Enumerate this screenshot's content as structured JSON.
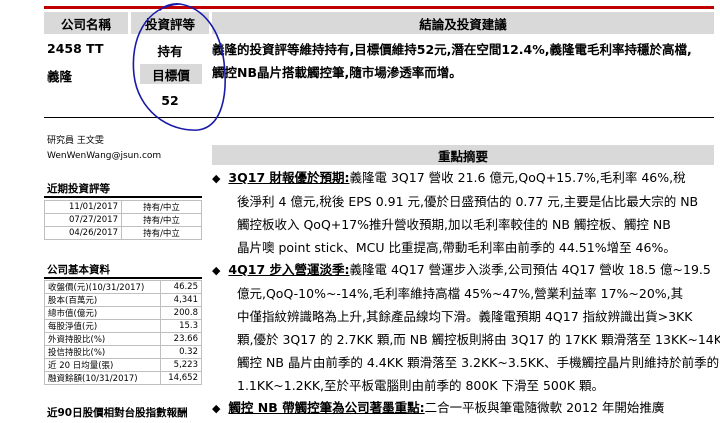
{
  "header": {
    "col1": "公司名稱",
    "col2": "投資評等",
    "col3": "結論及投資建議"
  },
  "company": {
    "ticker": "2458 TT",
    "name": "義隆"
  },
  "rating": {
    "value": "持有",
    "target_label": "目標價",
    "target_value": "52"
  },
  "conclusion": {
    "line1": "義隆的投資評等維持持有,目標價維持52元,潛在空間12.4%,義隆電毛利率持穩於高檔,",
    "line2": "觸控NB晶片搭載觸控筆,隨市場滲透率而增。"
  },
  "analyst": {
    "label": "研究員 王文雯",
    "email": "WenWenWang@jsun.com"
  },
  "recent_ratings": {
    "title": "近期投資評等",
    "rows": [
      {
        "date": "11/01/2017",
        "rating": "持有/中立"
      },
      {
        "date": "07/27/2017",
        "rating": "持有/中立"
      },
      {
        "date": "04/26/2017",
        "rating": "持有/中立"
      }
    ]
  },
  "basic_info": {
    "title": "公司基本資料",
    "rows": [
      {
        "label": "收盤價(元)(10/31/2017)",
        "value": "46.25"
      },
      {
        "label": "股本(百萬元)",
        "value": "4,341"
      },
      {
        "label": "總市值(億元)",
        "value": "200.8"
      },
      {
        "label": "每股淨值(元)",
        "value": "15.3"
      },
      {
        "label": "外資持股比(%)",
        "value": "23.66"
      },
      {
        "label": "投信持股比(%)",
        "value": "0.32"
      },
      {
        "label": "近 20 日均量(張)",
        "value": "5,223"
      },
      {
        "label": "融資餘額(10/31/2017)",
        "value": "14,652"
      }
    ]
  },
  "chart_section_title": "近90日股價相對台股指數報酬",
  "summary": {
    "title": "重點摘要",
    "p1_heading": "3Q17 財報優於預期:",
    "p1_lines": [
      "義隆電 3Q17 營收 21.6 億元,QoQ+15.7%,毛利率 46%,稅",
      "後淨利 4 億元,稅後 EPS 0.91 元,優於日盛預估的 0.77 元,主要是佔比最大宗的 NB",
      "觸控板收入 QoQ+17%推升營收預期,加以毛利率較佳的 NB 觸控板、觸控 NB",
      "晶片噢 point stick、MCU 比重提高,帶動毛利率由前季的 44.51%增至 46%。"
    ],
    "p2_heading": "4Q17 步入營運淡季:",
    "p2_lines": [
      "義隆電 4Q17 營運步入淡季,公司預估 4Q17 營收 18.5 億~19.5",
      "億元,QoQ-10%~-14%,毛利率維持高檔 45%~47%,營業利益率 17%~20%,其",
      "中僅指紋辨識略為上升,其餘產品線均下滑。義隆電預期 4Q17 指紋辨識出貨>3KK",
      "顆,優於 3Q17 的 2.7KK 顆,而 NB 觸控板則將由 3Q17 的 17KK 顆滑落至 13KK~14KK,",
      "觸控 NB 晶片由前季的 4.4KK 顆滑落至 3.2KK~3.5KK、手機觸控晶片則維持於前季的",
      "1.1KK~1.2KK,至於平板電腦則由前季的 800K 下滑至 500K 顆。"
    ],
    "p3_heading": "觸控 NB 帶觸控筆為公司著墨重點:",
    "p3_text": "二合一平板與筆電隨微軟 2012 年開始推廣",
    "bullet": "◆"
  },
  "annotation": {
    "color": "#1a1aa8"
  }
}
